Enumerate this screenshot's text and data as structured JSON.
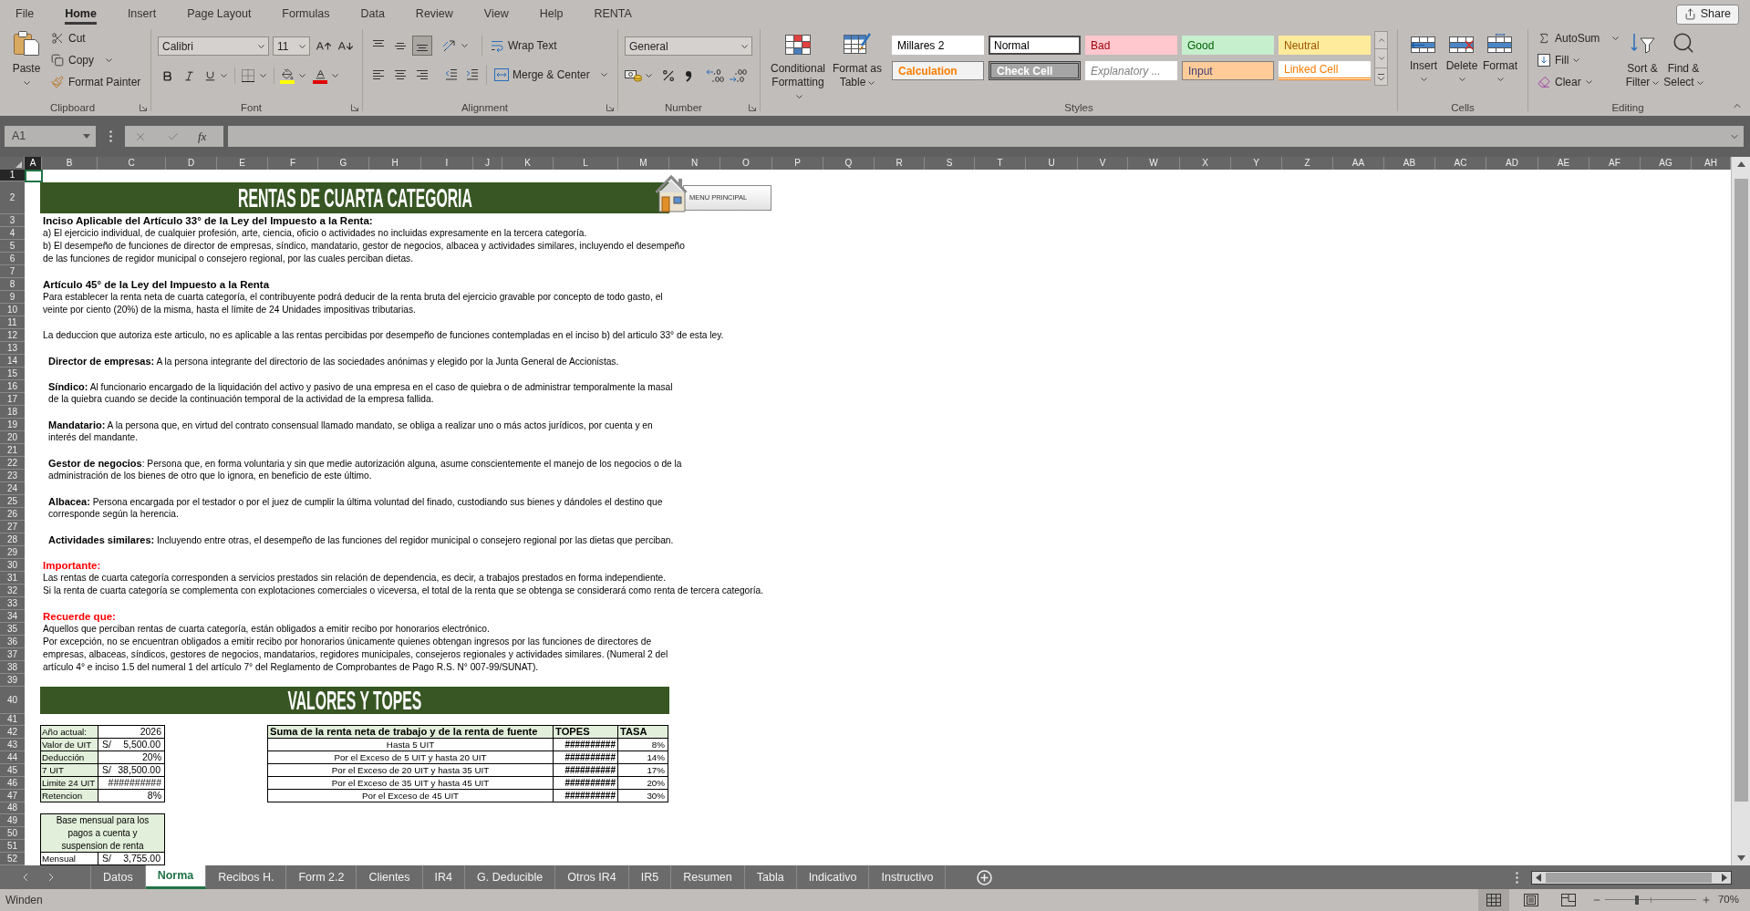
{
  "ribbon_tabs": [
    {
      "label": "File",
      "selected": false
    },
    {
      "label": "Home",
      "selected": true
    },
    {
      "label": "Insert",
      "selected": false
    },
    {
      "label": "Page Layout",
      "selected": false
    },
    {
      "label": "Formulas",
      "selected": false
    },
    {
      "label": "Data",
      "selected": false
    },
    {
      "label": "Review",
      "selected": false
    },
    {
      "label": "View",
      "selected": false
    },
    {
      "label": "Help",
      "selected": false
    },
    {
      "label": "RENTA",
      "selected": false
    }
  ],
  "share_button": "Share",
  "clipboard": {
    "label": "Clipboard",
    "paste": "Paste",
    "cut": "Cut",
    "copy": "Copy",
    "format_painter": "Format Painter"
  },
  "font": {
    "label": "Font",
    "family": "Calibri",
    "size": "11"
  },
  "alignment": {
    "label": "Alignment",
    "vertical": [
      {
        "kind": "top",
        "selected": false
      },
      {
        "kind": "middle",
        "selected": false
      },
      {
        "kind": "bottom",
        "selected": true
      }
    ],
    "horizontal": [
      {
        "kind": "left",
        "selected": false
      },
      {
        "kind": "center",
        "selected": false
      },
      {
        "kind": "right",
        "selected": false
      }
    ],
    "wrap_text": "Wrap Text",
    "merge_center": "Merge & Center"
  },
  "number": {
    "label": "Number",
    "format": "General"
  },
  "styles": {
    "label": "Styles",
    "conditional_formatting": "Conditional Formatting",
    "format_as_table": "Format as Table",
    "gallery": [
      {
        "label": "Millares 2",
        "kind": "normal",
        "selected": false
      },
      {
        "label": "Normal",
        "kind": "normal",
        "selected": true
      },
      {
        "label": "Bad",
        "kind": "bad",
        "selected": false
      },
      {
        "label": "Good",
        "kind": "good",
        "selected": false
      },
      {
        "label": "Neutral",
        "kind": "neutral",
        "selected": false
      },
      {
        "label": "Calculation",
        "kind": "calculation",
        "selected": false
      },
      {
        "label": "Check Cell",
        "kind": "check",
        "selected": false
      },
      {
        "label": "Explanatory ...",
        "kind": "explanatory",
        "selected": false
      },
      {
        "label": "Input",
        "kind": "input",
        "selected": false
      },
      {
        "label": "Linked Cell",
        "kind": "linked",
        "selected": false
      }
    ]
  },
  "cells": {
    "label": "Cells",
    "buttons": [
      {
        "kind": "insert",
        "label": "Insert"
      },
      {
        "kind": "delete",
        "label": "Delete"
      },
      {
        "kind": "format",
        "label": "Format"
      }
    ]
  },
  "editing": {
    "label": "Editing",
    "autosum": "AutoSum",
    "fill": "Fill",
    "clear": "Clear",
    "sort_filter": "Sort & Filter",
    "find_select": "Find & Select"
  },
  "formula_bar": {
    "name_box": "A1",
    "function_button": "fx"
  },
  "columns": [
    {
      "label": "A",
      "selected": true
    },
    {
      "label": "B",
      "selected": false
    },
    {
      "label": "C",
      "selected": false
    },
    {
      "label": "D",
      "selected": false
    },
    {
      "label": "E",
      "selected": false
    },
    {
      "label": "F",
      "selected": false
    },
    {
      "label": "G",
      "selected": false
    },
    {
      "label": "H",
      "selected": false
    },
    {
      "label": "I",
      "selected": false
    },
    {
      "label": "J",
      "selected": false
    },
    {
      "label": "K",
      "selected": false
    },
    {
      "label": "L",
      "selected": false
    },
    {
      "label": "M",
      "selected": false
    },
    {
      "label": "N",
      "selected": false
    },
    {
      "label": "O",
      "selected": false
    },
    {
      "label": "P",
      "selected": false
    },
    {
      "label": "Q",
      "selected": false
    },
    {
      "label": "R",
      "selected": false
    },
    {
      "label": "S",
      "selected": false
    },
    {
      "label": "T",
      "selected": false
    },
    {
      "label": "U",
      "selected": false
    },
    {
      "label": "V",
      "selected": false
    },
    {
      "label": "W",
      "selected": false
    },
    {
      "label": "X",
      "selected": false
    },
    {
      "label": "Y",
      "selected": false
    },
    {
      "label": "Z",
      "selected": false
    },
    {
      "label": "AA",
      "selected": false
    },
    {
      "label": "AB",
      "selected": false
    },
    {
      "label": "AC",
      "selected": false
    },
    {
      "label": "AD",
      "selected": false
    },
    {
      "label": "AE",
      "selected": false
    },
    {
      "label": "AF",
      "selected": false
    },
    {
      "label": "AG",
      "selected": false
    },
    {
      "label": "AH",
      "selected": false
    }
  ],
  "rows": [
    {
      "label": "1",
      "selected": true
    },
    {
      "label": "2",
      "selected": false
    },
    {
      "label": "3",
      "selected": false
    },
    {
      "label": "4",
      "selected": false
    },
    {
      "label": "5",
      "selected": false
    },
    {
      "label": "6",
      "selected": false
    },
    {
      "label": "7",
      "selected": false
    },
    {
      "label": "8",
      "selected": false
    },
    {
      "label": "9",
      "selected": false
    },
    {
      "label": "10",
      "selected": false
    },
    {
      "label": "11",
      "selected": false
    },
    {
      "label": "12",
      "selected": false
    },
    {
      "label": "13",
      "selected": false
    },
    {
      "label": "14",
      "selected": false
    },
    {
      "label": "15",
      "selected": false
    },
    {
      "label": "16",
      "selected": false
    },
    {
      "label": "17",
      "selected": false
    },
    {
      "label": "18",
      "selected": false
    },
    {
      "label": "19",
      "selected": false
    },
    {
      "label": "20",
      "selected": false
    },
    {
      "label": "21",
      "selected": false
    },
    {
      "label": "22",
      "selected": false
    },
    {
      "label": "23",
      "selected": false
    },
    {
      "label": "24",
      "selected": false
    },
    {
      "label": "25",
      "selected": false
    },
    {
      "label": "26",
      "selected": false
    },
    {
      "label": "27",
      "selected": false
    },
    {
      "label": "28",
      "selected": false
    },
    {
      "label": "29",
      "selected": false
    },
    {
      "label": "30",
      "selected": false
    },
    {
      "label": "31",
      "selected": false
    },
    {
      "label": "32",
      "selected": false
    },
    {
      "label": "33",
      "selected": false
    },
    {
      "label": "34",
      "selected": false
    },
    {
      "label": "35",
      "selected": false
    },
    {
      "label": "36",
      "selected": false
    },
    {
      "label": "37",
      "selected": false
    },
    {
      "label": "38",
      "selected": false
    },
    {
      "label": "39",
      "selected": false
    },
    {
      "label": "40",
      "selected": false
    },
    {
      "label": "41",
      "selected": false
    },
    {
      "label": "42",
      "selected": false
    },
    {
      "label": "43",
      "selected": false
    },
    {
      "label": "44",
      "selected": false
    },
    {
      "label": "45",
      "selected": false
    },
    {
      "label": "46",
      "selected": false
    },
    {
      "label": "47",
      "selected": false
    },
    {
      "label": "48",
      "selected": false
    },
    {
      "label": "49",
      "selected": false
    },
    {
      "label": "50",
      "selected": false
    },
    {
      "label": "51",
      "selected": false
    },
    {
      "label": "52",
      "selected": false
    }
  ],
  "sheet": {
    "title": "RENTAS DE CUARTA CATEGORIA",
    "menu_button": "MENU PRINCIPAL",
    "sections": [
      {
        "kind": "article",
        "title": "Inciso Aplicable del Artículo 33° de la Ley del Impuesto a la Renta:",
        "lines": [
          "a) El ejercicio individual, de cualquier profesión, arte, ciencia, oficio o actividades no incluidas expresamente en la tercera categoría.",
          "b) El desempeño de funciones de director de empresas, síndico, mandatario, gestor de negocios, albacea y actividades similares, incluyendo el desempeño",
          "de las funciones de regidor municipal o consejero regional, por las cuales perciban dietas."
        ]
      },
      {
        "kind": "article",
        "title": "Artículo 45° de la Ley del Impuesto a la Renta",
        "lines": [
          "Para establecer la renta neta de cuarta categoría, el contribuyente podrá deducir de la renta bruta del ejercicio gravable por concepto de todo gasto, el",
          "veinte por ciento (20%) de la misma, hasta el límite de 24 Unidades impositivas tributarias."
        ]
      },
      {
        "kind": "plain",
        "lines": [
          "La deduccion que autoriza este articulo, no es aplicable a las rentas percibidas por desempeño de funciones contempladas en el inciso b) del articulo 33° de esta ley."
        ]
      },
      {
        "kind": "definition",
        "lines": [
          "**Director de empresas:** A la persona integrante del directorio de las sociedades anónimas y elegido por la Junta General de Accionistas."
        ]
      },
      {
        "kind": "definition",
        "lines": [
          "**Síndico:** Al funcionario encargado de la liquidación del activo y pasivo de una empresa en el caso de quiebra o de administrar temporalmente la masal",
          "de la quiebra cuando se decide la continuación temporal de la actividad de la empresa fallida."
        ]
      },
      {
        "kind": "definition",
        "lines": [
          "**Mandatario:** A la persona que, en virtud del contrato consensual llamado mandato, se obliga a realizar uno o más actos jurídicos, por cuenta y en",
          "interés del mandante."
        ]
      },
      {
        "kind": "definition",
        "lines": [
          "**Gestor de negocios**: Persona que, en forma voluntaria y sin que medie autorización alguna, asume conscientemente el manejo de los negocios o de la",
          "administración de los bienes de otro que lo ignora, en beneficio de este último."
        ]
      },
      {
        "kind": "definition",
        "lines": [
          "**Albacea:** Persona encargada por el testador o por el juez de cumplir la última voluntad del finado, custodiando sus bienes y dándoles el destino que",
          "corresponde según la herencia."
        ]
      },
      {
        "kind": "definition",
        "lines": [
          "**Actividades similares:** Incluyendo entre otras, el desempeño de las funciones del regidor municipal o consejero regional por las dietas que perciban."
        ]
      },
      {
        "kind": "notice",
        "title": "Importante:",
        "lines": [
          "Las rentas de cuarta categoría corresponden a servicios prestados sin relación de dependencia, es decir, a trabajos prestados en forma independiente.",
          "Si la renta de cuarta categoría se complementa con explotaciones comerciales o viceversa, el total de la renta que se obtenga se considerará como renta de tercera categoría."
        ]
      },
      {
        "kind": "notice",
        "title": "Recuerde que:",
        "lines": [
          "Aquellos que perciban rentas de cuarta categoría, están obligados a emitir recibo por honorarios electrónico.",
          "Por excepción, no se encuentran obligados a emitir recibo por honorarios únicamente quienes obtengan ingresos por las funciones de directores de",
          "empresas, albaceas, síndicos, gestores de negocios, mandatarios, regidores municipales, consejeros regionales y actividades similares. (Numeral 2 del",
          "artículo 4° e inciso 1.5 del numeral 1 del artículo 7° del Reglamento de Comprobantes de Pago R.S. N° 007-99/SUNAT)."
        ]
      }
    ],
    "values_title": "VALORES Y TOPES",
    "parameters": [
      {
        "label": "Año actual:",
        "value": "2026"
      },
      {
        "label": "Valor de UIT",
        "currency": "S/",
        "value": "5,500.00"
      },
      {
        "label": "Deducción",
        "value": "20%"
      },
      {
        "label": "7 UIT",
        "currency": "S/",
        "value": "38,500.00"
      },
      {
        "label": "Limite 24 UIT",
        "value": "##########"
      },
      {
        "label": "Retencion",
        "value": "8%"
      }
    ],
    "rates": {
      "columns": [
        "Suma de la renta neta de trabajo y de la renta de fuente",
        "TOPES",
        "TASA"
      ],
      "rows": [
        {
          "range": "Hasta 5 UIT",
          "cap": "##########",
          "rate": "8%"
        },
        {
          "range": "Por el Exceso de 5 UIT y hasta 20 UIT",
          "cap": "##########",
          "rate": "14%"
        },
        {
          "range": "Por el Exceso de 20 UIT y hasta 35 UIT",
          "cap": "##########",
          "rate": "17%"
        },
        {
          "range": "Por el Exceso de 35 UIT y hasta 45 UIT",
          "cap": "##########",
          "rate": "20%"
        },
        {
          "range": "Por el Exceso de 45 UIT",
          "cap": "##########",
          "rate": "30%"
        }
      ]
    },
    "monthly_base": {
      "title": "Base mensual para los pagos a cuenta y suspension de renta",
      "label": "Mensual",
      "currency": "S/",
      "value": "3,755.00"
    }
  },
  "sheet_tabs": [
    {
      "label": "Datos",
      "selected": false
    },
    {
      "label": "Norma",
      "selected": true
    },
    {
      "label": "Recibos H.",
      "selected": false
    },
    {
      "label": "Form 2.2",
      "selected": false
    },
    {
      "label": "Clientes",
      "selected": false
    },
    {
      "label": "IR4",
      "selected": false
    },
    {
      "label": "G. Deducible",
      "selected": false
    },
    {
      "label": "Otros IR4",
      "selected": false
    },
    {
      "label": "IR5",
      "selected": false
    },
    {
      "label": "Resumen",
      "selected": false
    },
    {
      "label": "Tabla",
      "selected": false
    },
    {
      "label": "Indicativo",
      "selected": false
    },
    {
      "label": "Instructivo",
      "selected": false
    }
  ],
  "status_bar": {
    "text": "Winden",
    "views": [
      {
        "kind": "normal",
        "selected": true
      },
      {
        "kind": "page_layout",
        "selected": false
      },
      {
        "kind": "page_break",
        "selected": false
      }
    ],
    "zoom": {
      "level": 0.35,
      "reading": "70%"
    }
  }
}
